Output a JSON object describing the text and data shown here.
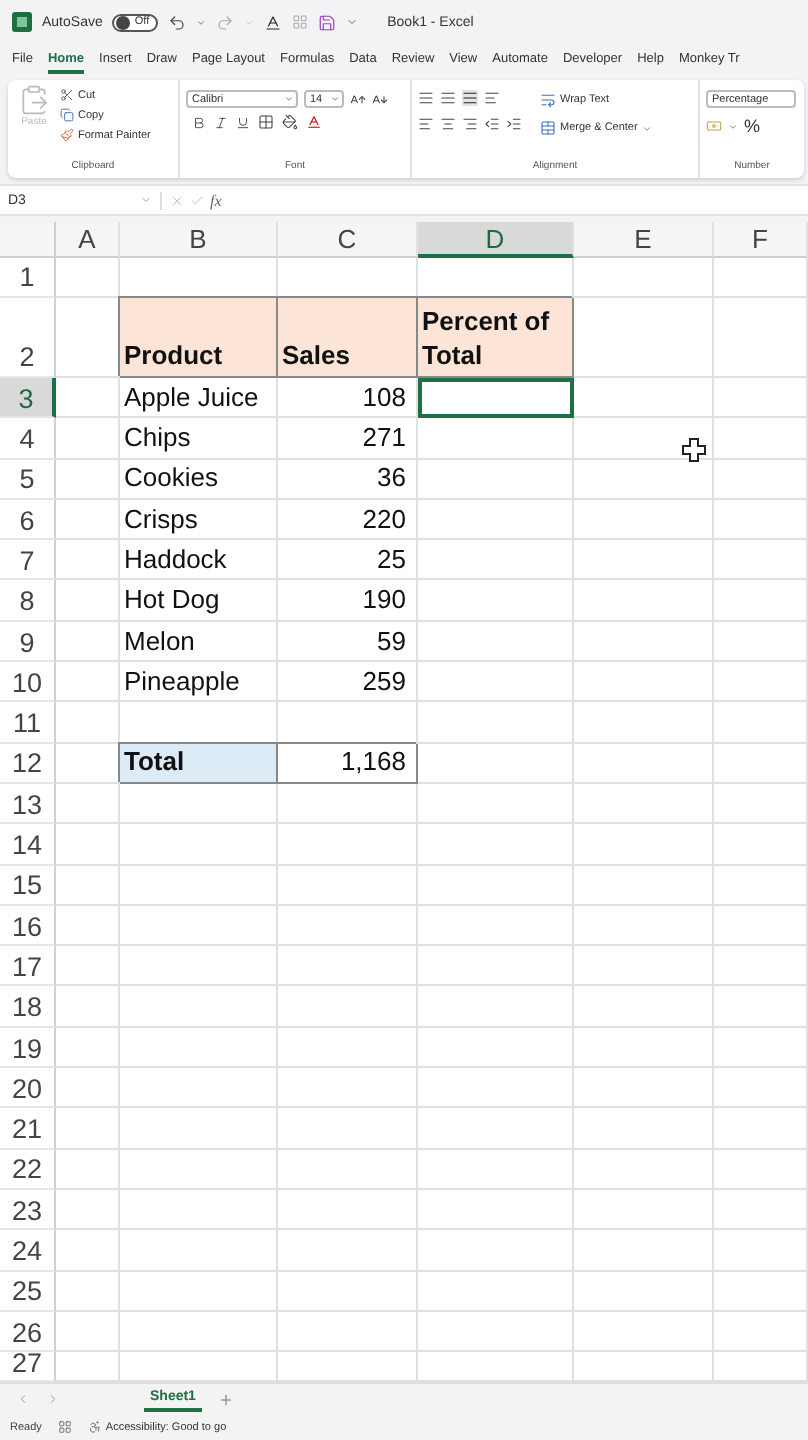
{
  "title_bar": {
    "autosave_label": "AutoSave",
    "autosave_state": "Off",
    "autosave_on": false,
    "document_title": "Book1 - Excel"
  },
  "menu_tabs": [
    {
      "label": "File",
      "selected": false
    },
    {
      "label": "Home",
      "selected": true
    },
    {
      "label": "Insert",
      "selected": false
    },
    {
      "label": "Draw",
      "selected": false
    },
    {
      "label": "Page Layout",
      "selected": false
    },
    {
      "label": "Formulas",
      "selected": false
    },
    {
      "label": "Data",
      "selected": false
    },
    {
      "label": "Review",
      "selected": false
    },
    {
      "label": "View",
      "selected": false
    },
    {
      "label": "Automate",
      "selected": false
    },
    {
      "label": "Developer",
      "selected": false
    },
    {
      "label": "Help",
      "selected": false
    },
    {
      "label": "Monkey Tr",
      "selected": false
    }
  ],
  "ribbon": {
    "clipboard": {
      "paste": "Paste",
      "paste_disabled": true,
      "cut": "Cut",
      "copy": "Copy",
      "format_painter": "Format Painter",
      "label": "Clipboard"
    },
    "font": {
      "name": "Calibri",
      "size": "14",
      "label": "Font"
    },
    "alignment": {
      "wrap_text": "Wrap Text",
      "merge_center": "Merge & Center",
      "label": "Alignment"
    },
    "number": {
      "format": "Percentage",
      "percent": "%",
      "label": "Number"
    }
  },
  "formula_bar": {
    "name_box": "D3",
    "function_label": "fx"
  },
  "columns": [
    {
      "label": "A",
      "selected": false
    },
    {
      "label": "B",
      "selected": false
    },
    {
      "label": "C",
      "selected": false
    },
    {
      "label": "D",
      "selected": true
    },
    {
      "label": "E",
      "selected": false
    },
    {
      "label": "F",
      "selected": false
    }
  ],
  "rows": [
    {
      "label": "1",
      "selected": false
    },
    {
      "label": "2",
      "selected": false
    },
    {
      "label": "3",
      "selected": true
    },
    {
      "label": "4",
      "selected": false
    },
    {
      "label": "5",
      "selected": false
    },
    {
      "label": "6",
      "selected": false
    },
    {
      "label": "7",
      "selected": false
    },
    {
      "label": "8",
      "selected": false
    },
    {
      "label": "9",
      "selected": false
    },
    {
      "label": "10",
      "selected": false
    },
    {
      "label": "11",
      "selected": false
    },
    {
      "label": "12",
      "selected": false
    },
    {
      "label": "13",
      "selected": false
    },
    {
      "label": "14",
      "selected": false
    },
    {
      "label": "15",
      "selected": false
    },
    {
      "label": "16",
      "selected": false
    },
    {
      "label": "17",
      "selected": false
    },
    {
      "label": "18",
      "selected": false
    },
    {
      "label": "19",
      "selected": false
    },
    {
      "label": "20",
      "selected": false
    },
    {
      "label": "21",
      "selected": false
    },
    {
      "label": "22",
      "selected": false
    },
    {
      "label": "23",
      "selected": false
    },
    {
      "label": "24",
      "selected": false
    },
    {
      "label": "25",
      "selected": false
    },
    {
      "label": "26",
      "selected": false
    },
    {
      "label": "27",
      "selected": false
    }
  ],
  "table": {
    "header": [
      "Product",
      "Sales",
      "Percent of Total"
    ],
    "rows": [
      [
        "Apple Juice",
        "108"
      ],
      [
        "Chips",
        "271"
      ],
      [
        "Cookies",
        "36"
      ],
      [
        "Crisps",
        "220"
      ],
      [
        "Haddock",
        "25"
      ],
      [
        "Hot Dog",
        "190"
      ],
      [
        "Melon",
        "59"
      ],
      [
        "Pineapple",
        "259"
      ]
    ],
    "total": [
      "Total",
      "1,168"
    ]
  },
  "sheet_tabs": [
    {
      "label": "Sheet1",
      "selected": true
    }
  ],
  "status_bar": {
    "mode": "Ready",
    "accessibility": "Accessibility: Good to go"
  }
}
